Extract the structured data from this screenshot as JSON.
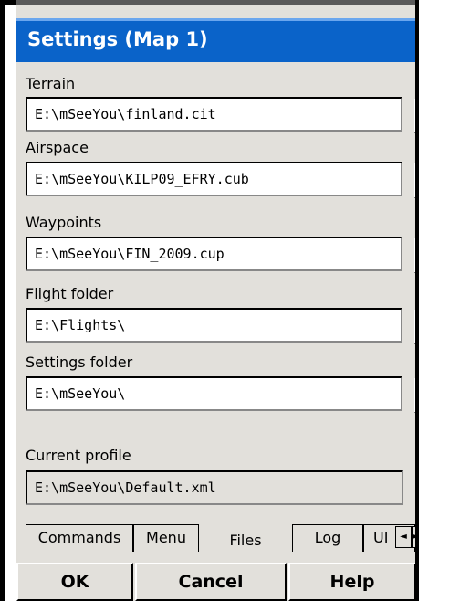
{
  "window": {
    "title": "Settings (Map 1)"
  },
  "fields": [
    {
      "label": "Terrain",
      "value": "E:\\mSeeYou\\finland.cit",
      "browse": "..."
    },
    {
      "label": "Airspace",
      "value": "E:\\mSeeYou\\KILP09_EFRY.cub",
      "browse": "..."
    },
    {
      "label": "Waypoints",
      "value": "E:\\mSeeYou\\FIN_2009.cup",
      "browse": "..."
    },
    {
      "label": "Flight folder",
      "value": "E:\\Flights\\",
      "browse": "..."
    },
    {
      "label": "Settings folder",
      "value": "E:\\mSeeYou\\",
      "browse": "..."
    }
  ],
  "profile": {
    "label": "Current profile",
    "value": "E:\\mSeeYou\\Default.xml"
  },
  "tabs": [
    {
      "label": "Commands"
    },
    {
      "label": "Menu"
    },
    {
      "label": "Files",
      "active": true
    },
    {
      "label": "Log"
    },
    {
      "label": "UI"
    }
  ],
  "tab_scroll": {
    "left": "◄",
    "right": "►"
  },
  "buttons": {
    "ok": "OK",
    "cancel": "Cancel",
    "help": "Help"
  }
}
